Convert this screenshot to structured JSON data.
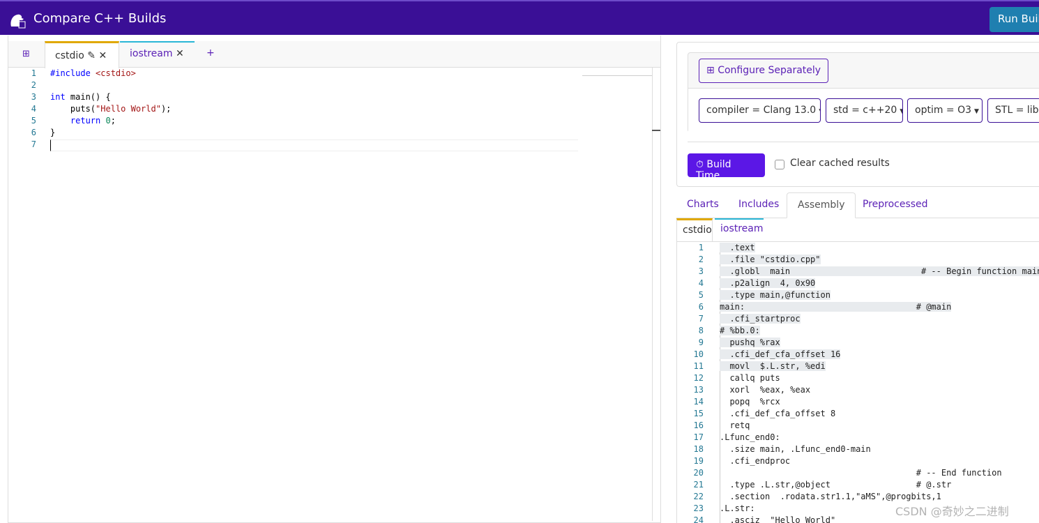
{
  "header": {
    "title": "Compare C++ Builds",
    "run_label": "Run Build",
    "bg": "#3a0f96"
  },
  "editor": {
    "tabs": [
      {
        "label": "cstdio",
        "active": true
      },
      {
        "label": "iostream",
        "active": false
      }
    ],
    "add_label": "+",
    "lines": [
      [
        [
          "#include ",
          "#0000ff"
        ],
        [
          "<cstdio>",
          "#a31515"
        ]
      ],
      [],
      [
        [
          "int",
          "#0000ff"
        ],
        [
          " main() {",
          "#000"
        ]
      ],
      [
        [
          "    puts(",
          "#000"
        ],
        [
          "\"Hello World\"",
          "#a31515"
        ],
        [
          ");",
          "#000"
        ]
      ],
      [
        [
          "    return ",
          "#0000ff"
        ],
        [
          "0",
          "#098658"
        ],
        [
          ";",
          "#000"
        ]
      ],
      [
        [
          "}",
          "#000"
        ]
      ],
      []
    ]
  },
  "config": {
    "configure_label": "Configure Separately",
    "options": [
      "compiler = Clang 13.0",
      "std = c++20",
      "optim = O3",
      "STL = libstdc++"
    ],
    "build_label": "Build Time",
    "clear_label": "Clear cached results",
    "clear_checked": false
  },
  "result_tabs": [
    "Charts",
    "Includes",
    "Assembly",
    "Preprocessed"
  ],
  "active_result_tab": "Assembly",
  "file_tabs": [
    "cstdio",
    "iostream"
  ],
  "assembly": [
    "  .text",
    "  .file \"cstdio.cpp\"",
    "  .globl  main                          # -- Begin function main",
    "  .p2align  4, 0x90",
    "  .type main,@function",
    "main:                                  # @main",
    "  .cfi_startproc",
    "# %bb.0:",
    "  pushq %rax",
    "  .cfi_def_cfa_offset 16",
    "  movl  $.L.str, %edi",
    "  callq puts",
    "  xorl  %eax, %eax",
    "  popq  %rcx",
    "  .cfi_def_cfa_offset 8",
    "  retq",
    ".Lfunc_end0:",
    "  .size main, .Lfunc_end0-main",
    "  .cfi_endproc",
    "                                       # -- End function",
    "  .type .L.str,@object                 # @.str",
    "  .section  .rodata.str1.1,\"aMS\",@progbits,1",
    ".L.str:",
    "  .asciz  \"Hello World\""
  ],
  "watermark": "CSDN @奇妙之二进制"
}
